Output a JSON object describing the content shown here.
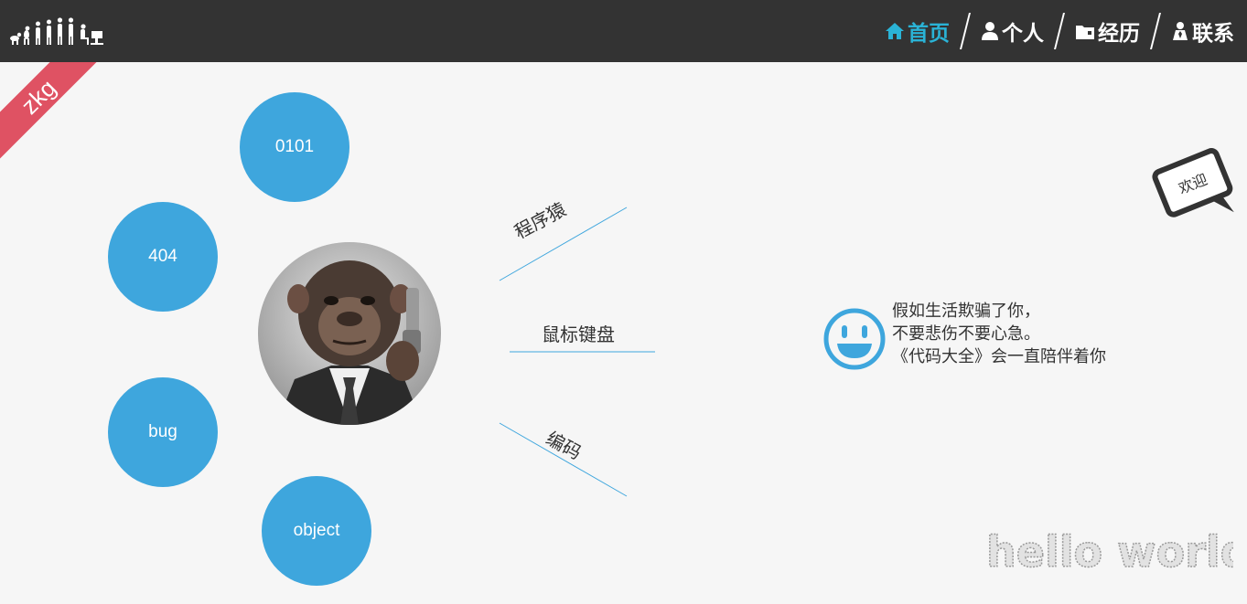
{
  "nav": {
    "items": [
      {
        "label": "首页",
        "icon": "home-icon",
        "active": true
      },
      {
        "label": "个人",
        "icon": "user-icon",
        "active": false
      },
      {
        "label": "经历",
        "icon": "folder-icon",
        "active": false
      },
      {
        "label": "联系",
        "icon": "contact-icon",
        "active": false
      }
    ],
    "active_color": "#2ab3d6"
  },
  "ribbon": {
    "text": "zkg",
    "color": "#df5263"
  },
  "bubbles": [
    "0101",
    "404",
    "bug",
    "object"
  ],
  "bubble_color": "#3ea6dd",
  "branches": [
    "程序猿",
    "鼠标键盘",
    "编码"
  ],
  "quote": {
    "lines": [
      "假如生活欺骗了你，",
      "不要悲伤不要心急。",
      "《代码大全》会一直陪伴着你"
    ]
  },
  "welcome": {
    "text": "欢迎"
  },
  "watermark": {
    "text": "hello world"
  }
}
